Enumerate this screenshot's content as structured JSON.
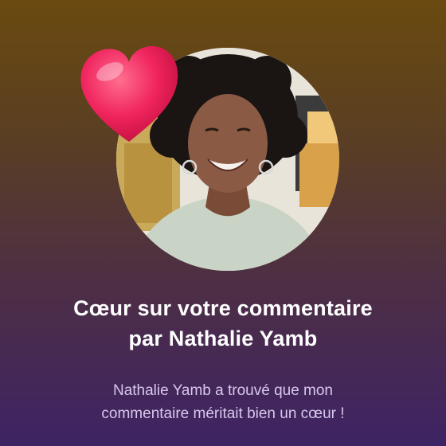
{
  "notification": {
    "title_line1": "Cœur sur votre commentaire",
    "title_line2": "par Nathalie Yamb",
    "message_line1": "Nathalie Yamb a trouvé que mon",
    "message_line2": "commentaire méritait bien un cœur !"
  },
  "icons": {
    "heart": "heart-icon",
    "avatar": "profile-photo"
  },
  "colors": {
    "background_top": "#6a4a10",
    "background_bottom": "#3e2364",
    "heart": "#f0245e",
    "title": "#ffffff",
    "message": "#d8c8ec"
  }
}
